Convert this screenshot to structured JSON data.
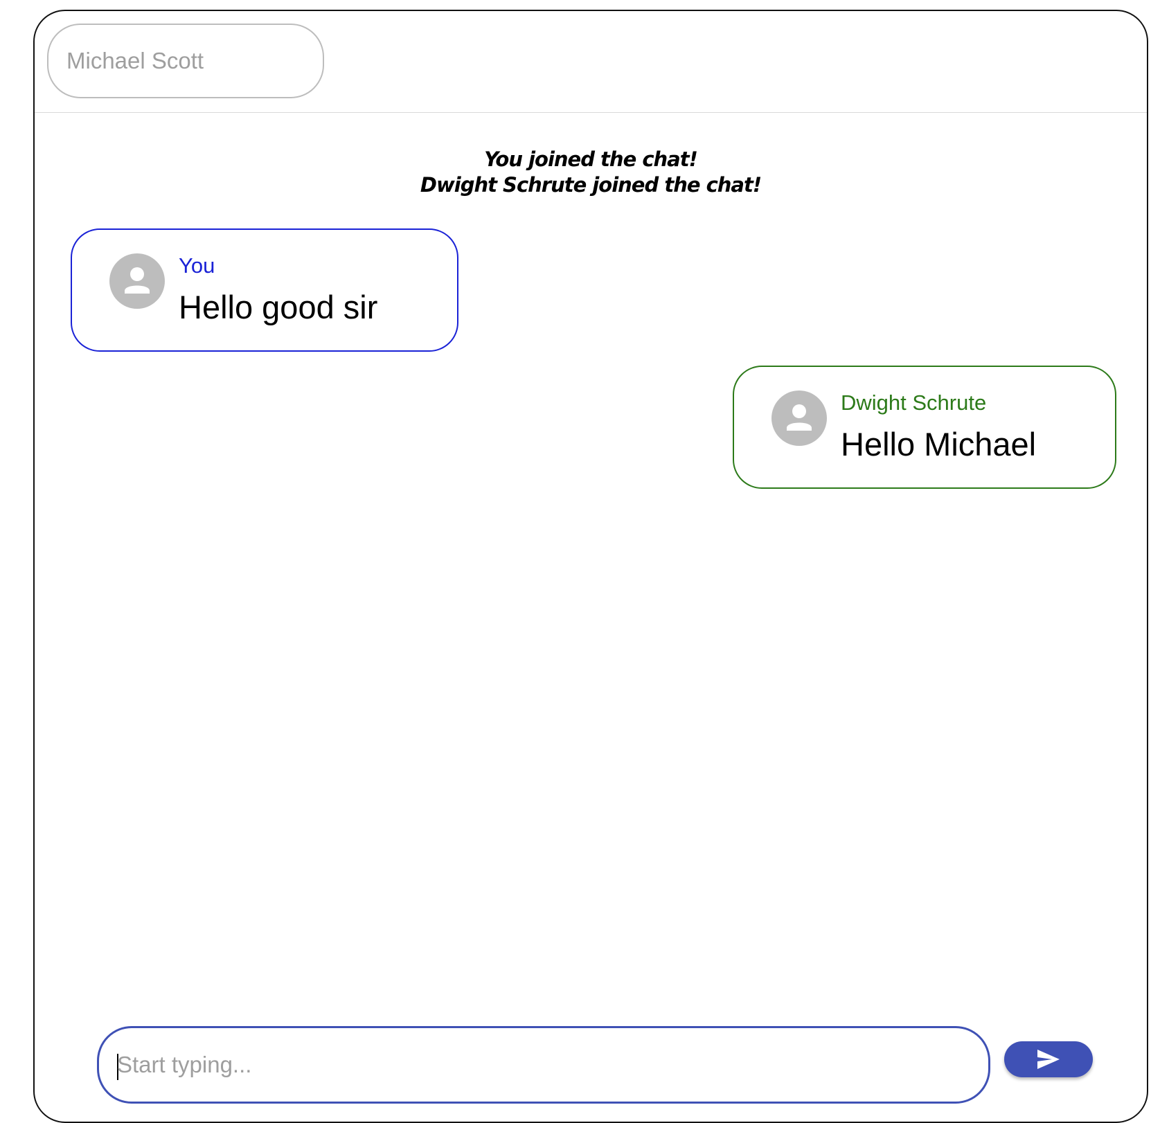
{
  "header": {
    "name_field": {
      "value": "",
      "placeholder": "Michael Scott"
    }
  },
  "system_messages": [
    "You joined the chat!",
    "Dwight Schrute joined the chat!"
  ],
  "messages": [
    {
      "sender": "You",
      "text": "Hello good sir",
      "avatar_icon": "person-icon",
      "accent_color": "#1a22d6"
    },
    {
      "sender": "Dwight Schrute",
      "text": "Hello Michael",
      "avatar_icon": "person-icon",
      "accent_color": "#2c7a19"
    }
  ],
  "composer": {
    "value": "",
    "placeholder": "Start typing...",
    "send_icon": "send-icon",
    "send_color": "#3f51b5"
  }
}
